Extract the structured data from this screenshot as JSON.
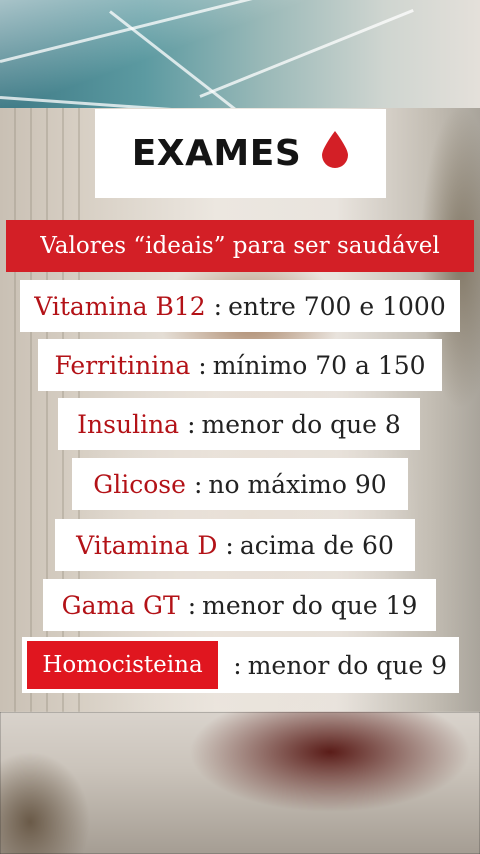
{
  "title": {
    "text": "EXAMES",
    "icon": "blood-drop-icon",
    "icon_color": "#d31f26"
  },
  "subtitle": "Valores “ideais” para ser saudável",
  "accent_color": "#d31f26",
  "exams": [
    {
      "name": "Vitamina B12",
      "value": "entre 700 e 1000"
    },
    {
      "name": "Ferritinina",
      "value": "mínimo 70 a 150"
    },
    {
      "name": "Insulina",
      "value": "menor do que 8"
    },
    {
      "name": "Glicose",
      "value": "no máximo 90"
    },
    {
      "name": "Vitamina D",
      "value": "acima de 60"
    },
    {
      "name": "Gama GT",
      "value": "menor do que 19"
    },
    {
      "name": "Homocisteina",
      "value": "menor do que 9"
    }
  ],
  "separator": ":"
}
